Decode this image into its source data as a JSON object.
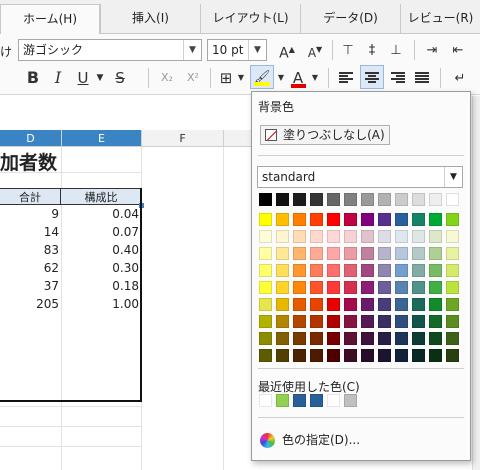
{
  "tabs": [
    "ホーム(H)",
    "挿入(I)",
    "レイアウト(L)",
    "データ(D)",
    "レビュー(R)"
  ],
  "toolbar": {
    "style_fragment": "け",
    "font_name": "游ゴシック",
    "font_size": "10 pt",
    "grow_icon": "A",
    "shrink_icon": "A",
    "bold_label": "B",
    "italic_label": "I",
    "underline_label": "U",
    "strike_label": "S",
    "subscript_label": "X₂",
    "superscript_label": "X²",
    "font_color_label": "A",
    "highlight_color": "#ffff00",
    "font_color": "#e00000"
  },
  "sheet": {
    "columns": [
      "D",
      "E",
      "F"
    ],
    "title": "加者数",
    "headers": [
      "合計",
      "構成比"
    ],
    "rows": [
      {
        "total": "9",
        "ratio": "0.04"
      },
      {
        "total": "14",
        "ratio": "0.07"
      },
      {
        "total": "83",
        "ratio": "0.40"
      },
      {
        "total": "62",
        "ratio": "0.30"
      },
      {
        "total": "37",
        "ratio": "0.18"
      },
      {
        "total": "205",
        "ratio": "1.00"
      }
    ]
  },
  "popup": {
    "heading": "背景色",
    "no_fill": "塗りつぶしなし(A)",
    "palette": "standard",
    "recent_label": "最近使用した色(C)",
    "custom_label": "色の指定(D)...",
    "recent_colors": [
      "#ffffff",
      "#92d050",
      "#2a6099",
      "#2a6099",
      "#ffffff",
      "#c0c0c0"
    ],
    "colors": [
      [
        "#000000",
        "#111111",
        "#1c1c1c",
        "#333333",
        "#666666",
        "#808080",
        "#999999",
        "#b2b2b2",
        "#cccccc",
        "#dddddd",
        "#eeeeee",
        "#ffffff"
      ],
      [
        "#ffff00",
        "#ffbf00",
        "#ff8000",
        "#ff4000",
        "#ff0000",
        "#bf0041",
        "#800080",
        "#55308d",
        "#2a6099",
        "#158466",
        "#00a933",
        "#81d41a"
      ],
      [
        "#ffffd7",
        "#fff5ce",
        "#ffdbb6",
        "#ffd8ce",
        "#ffd7d7",
        "#f7d1d5",
        "#e0c2cd",
        "#dedce6",
        "#dee6ef",
        "#dee7e5",
        "#dde8cb",
        "#f6f9d4"
      ],
      [
        "#ffffa6",
        "#ffe994",
        "#ffb66c",
        "#ffaa95",
        "#ffa6a6",
        "#ec9ba4",
        "#bf819e",
        "#b7b3ca",
        "#b4c7dc",
        "#b3cac7",
        "#afd095",
        "#e8f2a1"
      ],
      [
        "#ffff6d",
        "#ffde59",
        "#ff972f",
        "#ff7b59",
        "#ff6d6d",
        "#e16173",
        "#a1467e",
        "#8e86ae",
        "#729fcf",
        "#81aca6",
        "#77bc65",
        "#d4ea6b"
      ],
      [
        "#ffff38",
        "#ffd428",
        "#ff860d",
        "#ff5429",
        "#ff3838",
        "#d62e4e",
        "#8d1d75",
        "#6b5e9b",
        "#5983b0",
        "#50938a",
        "#3faf46",
        "#bbe33d"
      ],
      [
        "#e6e64c",
        "#e6b900",
        "#e65c00",
        "#e64400",
        "#e60000",
        "#a7074b",
        "#6a1b6a",
        "#483d7a",
        "#3b6594",
        "#1b6b5d",
        "#128b2c",
        "#6ba625"
      ],
      [
        "#b2b200",
        "#b28500",
        "#b24700",
        "#b23500",
        "#b20000",
        "#871440",
        "#551a55",
        "#3b2f62",
        "#2e4e7e",
        "#11564a",
        "#126928",
        "#5b8c20"
      ],
      [
        "#8c8c00",
        "#806000",
        "#783b00",
        "#782b00",
        "#780000",
        "#5d1233",
        "#3e143e",
        "#282047",
        "#1b3656",
        "#0c3d34",
        "#0e4a1d",
        "#3f6117"
      ],
      [
        "#5c5c00",
        "#524000",
        "#4c2400",
        "#4c1b00",
        "#4c0000",
        "#3d0d22",
        "#280d28",
        "#1a142e",
        "#112238",
        "#082822",
        "#093014",
        "#28400f"
      ]
    ]
  }
}
